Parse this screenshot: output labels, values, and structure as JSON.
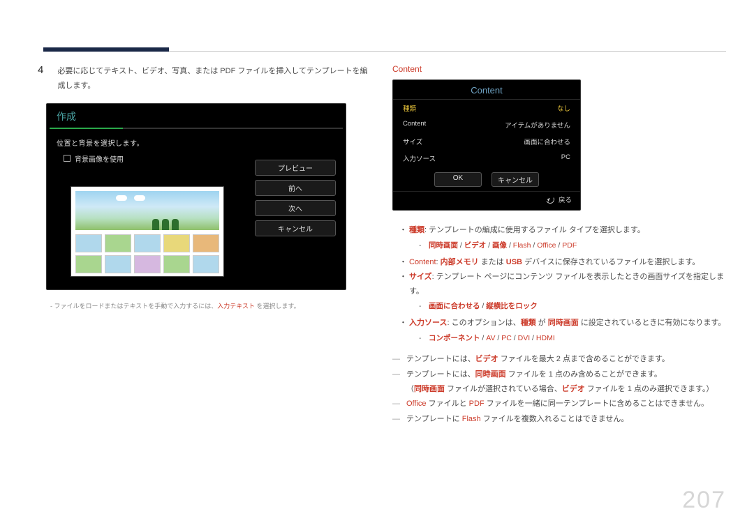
{
  "page_number": "207",
  "left": {
    "step_number": "4",
    "step_text": "必要に応じてテキスト、ビデオ、写真、または PDF ファイルを挿入してテンプレートを編成します。",
    "osd": {
      "title": "作成",
      "instruction": "位置と背景を選択します。",
      "checkbox_label": "背景画像を使用",
      "buttons": {
        "preview": "プレビュー",
        "previous": "前へ",
        "next": "次へ",
        "cancel": "キャンセル"
      }
    },
    "footnote": {
      "prefix": "ファイルをロードまたはテキストを手動で入力するには、",
      "hl": "入力テキスト",
      "suffix": " を選択します。"
    }
  },
  "right": {
    "heading": "Content",
    "osd": {
      "title": "Content",
      "rows": [
        {
          "label": "種類",
          "value": "なし",
          "hl": true
        },
        {
          "label": "Content",
          "value": "アイテムがありません",
          "hl": false
        },
        {
          "label": "サイズ",
          "value": "画面に合わせる",
          "hl": false
        },
        {
          "label": "入力ソース",
          "value": "PC",
          "hl": false
        }
      ],
      "ok": "OK",
      "cancel": "キャンセル",
      "return": "戻る"
    },
    "bullets": {
      "type": {
        "label": "種類",
        "text": ": テンプレートの編成に使用するファイル タイプを選択します。",
        "sub_parts": [
          "同時画面",
          "ビデオ",
          "画像",
          "Flash",
          "Office",
          "PDF"
        ]
      },
      "content": {
        "label": "Content",
        "hl2": "内部メモリ",
        "mid": " または ",
        "hl3": "USB",
        "suffix": " デバイスに保存されているファイルを選択します。"
      },
      "size": {
        "label": "サイズ",
        "text": ": テンプレート ページにコンテンツ ファイルを表示したときの画面サイズを指定します。",
        "sub_parts": [
          "画面に合わせる",
          "縦横比をロック"
        ]
      },
      "source": {
        "label": "入力ソース",
        "prefix": ": このオプションは、",
        "hl2": "種類",
        "mid": " が ",
        "hl3": "同時画面",
        "suffix": " に設定されているときに有効になります。",
        "sub_parts": [
          "コンポーネント",
          "AV",
          "PC",
          "DVI",
          "HDMI"
        ]
      }
    },
    "dashes": {
      "d1": {
        "p1": "テンプレートには、",
        "hl": "ビデオ",
        "p2": " ファイルを最大 2 点まで含めることができます。"
      },
      "d2": {
        "p1": "テンプレートには、",
        "hl": "同時画面",
        "p2": " ファイルを 1 点のみ含めることができます。"
      },
      "d2b": {
        "open": "（",
        "hl1": "同時画面",
        "mid": " ファイルが選択されている場合、",
        "hl2": "ビデオ",
        "p2": " ファイルを 1 点のみ選択できます。",
        "close": "）"
      },
      "d3": {
        "hl1": "Office",
        "p1": " ファイルと ",
        "hl2": "PDF",
        "p2": " ファイルを一緒に同一テンプレートに含めることはできません。"
      },
      "d4": {
        "p1": "テンプレートに ",
        "hl": "Flash",
        "p2": " ファイルを複数入れることはできません。"
      }
    }
  }
}
